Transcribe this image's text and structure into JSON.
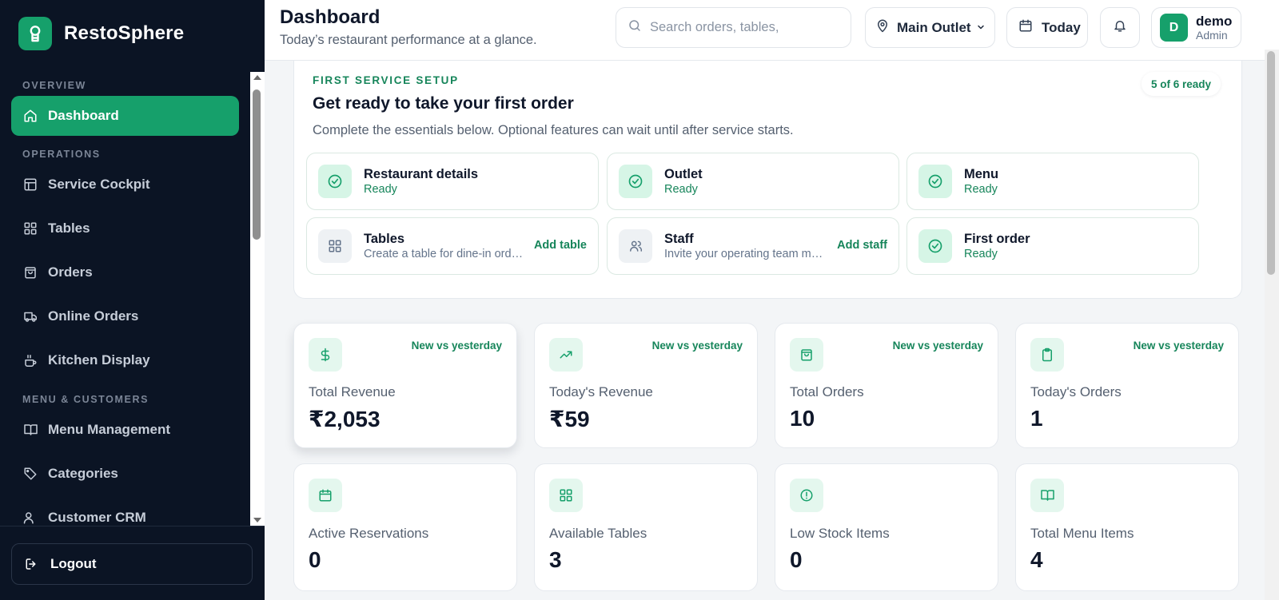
{
  "brand": {
    "name": "RestoSphere"
  },
  "sidebar": {
    "sections": {
      "overview": "OVERVIEW",
      "operations": "OPERATIONS",
      "menu_customers": "MENU & CUSTOMERS"
    },
    "items": [
      {
        "label": "Dashboard",
        "icon": "home-icon",
        "active": true
      },
      {
        "label": "Service Cockpit",
        "icon": "layout-icon"
      },
      {
        "label": "Tables",
        "icon": "grid-icon"
      },
      {
        "label": "Orders",
        "icon": "shopping-bag-icon"
      },
      {
        "label": "Online Orders",
        "icon": "truck-icon"
      },
      {
        "label": "Kitchen Display",
        "icon": "cooking-pot-icon"
      },
      {
        "label": "Menu Management",
        "icon": "book-open-icon"
      },
      {
        "label": "Categories",
        "icon": "tag-icon"
      },
      {
        "label": "Customer CRM",
        "icon": "users-icon"
      }
    ],
    "logout_label": "Logout"
  },
  "header": {
    "title": "Dashboard",
    "subtitle": "Today’s restaurant performance at a glance.",
    "search_placeholder": "Search orders, tables,",
    "outlet": "Main Outlet",
    "date_filter": "Today",
    "user": {
      "initial": "D",
      "name": "demo",
      "role": "Admin"
    }
  },
  "setup": {
    "eyebrow": "FIRST SERVICE SETUP",
    "title": "Get ready to take your first order",
    "subtitle": "Complete the essentials below. Optional features can wait until after service starts.",
    "progress": "5 of 6 ready",
    "steps": [
      {
        "title": "Restaurant details",
        "status": "Ready",
        "done": true
      },
      {
        "title": "Outlet",
        "status": "Ready",
        "done": true
      },
      {
        "title": "Menu",
        "status": "Ready",
        "done": true
      },
      {
        "title": "Tables",
        "status": "Create a table for dine-in orders",
        "done": false,
        "action": "Add table"
      },
      {
        "title": "Staff",
        "status": "Invite your operating team members",
        "done": false,
        "action": "Add staff"
      },
      {
        "title": "First order",
        "status": "Ready",
        "done": true
      }
    ]
  },
  "stats": [
    {
      "label": "Total Revenue",
      "value": "₹2,053",
      "badge": "New vs yesterday",
      "icon": "dollar-icon"
    },
    {
      "label": "Today's Revenue",
      "value": "₹59",
      "badge": "New vs yesterday",
      "icon": "trending-up-icon"
    },
    {
      "label": "Total Orders",
      "value": "10",
      "badge": "New vs yesterday",
      "icon": "shopping-bag-icon"
    },
    {
      "label": "Today's Orders",
      "value": "1",
      "badge": "New vs yesterday",
      "icon": "clipboard-icon"
    },
    {
      "label": "Active Reservations",
      "value": "0",
      "icon": "calendar-icon"
    },
    {
      "label": "Available Tables",
      "value": "3",
      "icon": "grid-icon"
    },
    {
      "label": "Low Stock Items",
      "value": "0",
      "icon": "alert-circle-icon"
    },
    {
      "label": "Total Menu Items",
      "value": "4",
      "icon": "book-open-icon"
    }
  ],
  "colors": {
    "accent": "#16a06b",
    "accent_text": "#16855a",
    "sidebar_bg": "#0b1424",
    "page_bg": "#f3f5f7"
  }
}
